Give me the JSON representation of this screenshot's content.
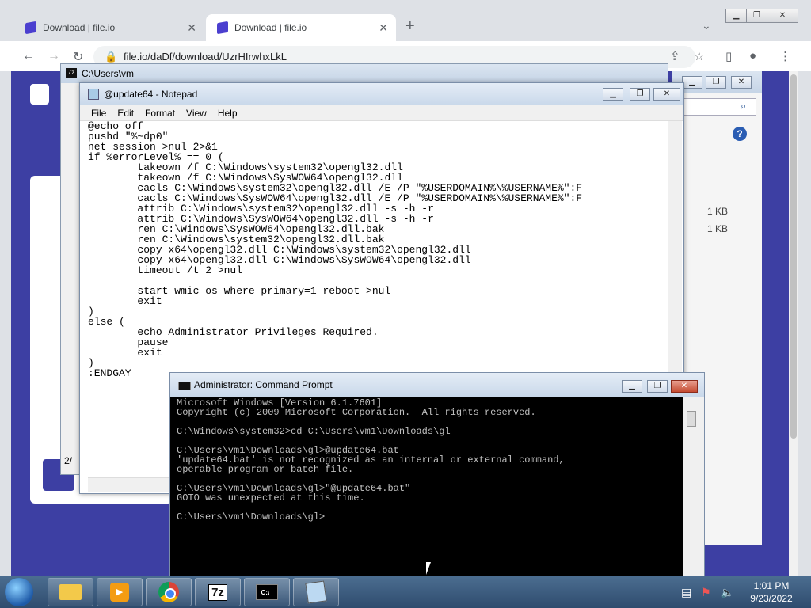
{
  "browser": {
    "tabs": [
      {
        "title": "Download | file.io"
      },
      {
        "title": "Download | file.io"
      }
    ],
    "url": "file.io/daDf/download/UzrHIrwhxLkL",
    "new_tab": "+",
    "close": "✕"
  },
  "sevenzip": {
    "title": "C:\\Users\\vm",
    "status": "2/"
  },
  "explorer": {
    "sizes": [
      "1 KB",
      "1 KB"
    ],
    "help": "?"
  },
  "notepad": {
    "title": "@update64 - Notepad",
    "menu": [
      "File",
      "Edit",
      "Format",
      "View",
      "Help"
    ],
    "text": "@echo off\npushd \"%~dp0\"\nnet session >nul 2>&1\nif %errorLevel% == 0 (\n        takeown /f C:\\Windows\\system32\\opengl32.dll\n        takeown /f C:\\Windows\\SysWOW64\\opengl32.dll\n        cacls C:\\Windows\\system32\\opengl32.dll /E /P \"%USERDOMAIN%\\%USERNAME%\":F\n        cacls C:\\Windows\\SysWOW64\\opengl32.dll /E /P \"%USERDOMAIN%\\%USERNAME%\":F\n        attrib C:\\Windows\\system32\\opengl32.dll -s -h -r\n        attrib C:\\Windows\\SysWOW64\\opengl32.dll -s -h -r\n        ren C:\\Windows\\SysWOW64\\opengl32.dll.bak\n        ren C:\\Windows\\system32\\opengl32.dll.bak\n        copy x64\\opengl32.dll C:\\Windows\\system32\\opengl32.dll\n        copy x64\\opengl32.dll C:\\Windows\\SysWOW64\\opengl32.dll\n        timeout /t 2 >nul\n\n        start wmic os where primary=1 reboot >nul\n        exit\n)\nelse (\n        echo Administrator Privileges Required.\n        pause\n        exit\n)\n:ENDGAY"
  },
  "cmd": {
    "title": "Administrator: Command Prompt",
    "text": "Microsoft Windows [Version 6.1.7601]\nCopyright (c) 2009 Microsoft Corporation.  All rights reserved.\n\nC:\\Windows\\system32>cd C:\\Users\\vm1\\Downloads\\gl\n\nC:\\Users\\vm1\\Downloads\\gl>@update64.bat\n'update64.bat' is not recognized as an internal or external command,\noperable program or batch file.\n\nC:\\Users\\vm1\\Downloads\\gl>\"@update64.bat\"\nGOTO was unexpected at this time.\n\nC:\\Users\\vm1\\Downloads\\gl>"
  },
  "window_buttons": {
    "minimize": "▁",
    "maximize": "❐",
    "close": "✕"
  },
  "taskbar": {
    "sevenzip_label": "7z",
    "cmd_label": "C:\\_",
    "time": "1:01 PM",
    "date": "9/23/2022"
  }
}
